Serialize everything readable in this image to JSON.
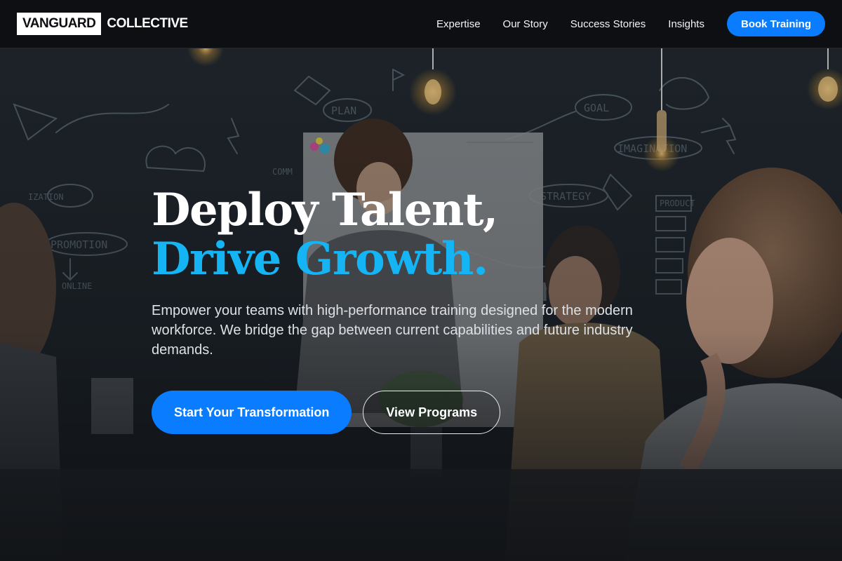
{
  "brand": {
    "logo_box": "VANGUARD",
    "logo_text": "COLLECTIVE"
  },
  "nav": {
    "items": [
      {
        "label": "Expertise"
      },
      {
        "label": "Our Story"
      },
      {
        "label": "Success Stories"
      },
      {
        "label": "Insights"
      }
    ],
    "cta_label": "Book Training"
  },
  "hero": {
    "title_line1": "Deploy Talent,",
    "title_line2": "Drive Growth.",
    "subtitle": "Empower your teams with high-performance training designed for the modern workforce. We bridge the gap between current capabilities and future industry demands.",
    "primary_cta": "Start Your Transformation",
    "secondary_cta": "View Programs",
    "background_chalk_words": [
      "PLAN",
      "GOAL",
      "IMAGINATION",
      "STRATEGY",
      "PROMOTION",
      "PRODUCT",
      "ONLINE"
    ]
  },
  "colors": {
    "accent": "#0a7cff",
    "headline_highlight": "#14b4f5",
    "header_bg": "#0d0f12"
  }
}
